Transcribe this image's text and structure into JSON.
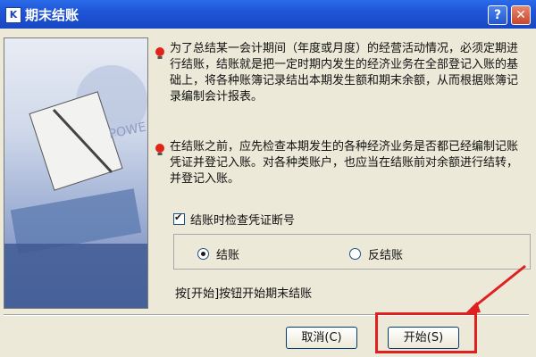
{
  "window": {
    "title": "期末结账",
    "app_icon_text": "K",
    "help_label": "?",
    "close_label": "✕"
  },
  "tips": [
    "为了总结某一会计期间（年度或月度）的经营活动情况，必须定期进行结账，结账就是把一定时期内发生的经济业务在全部登记入账的基础上，将各种账簿记录结出本期发生额和期末余额，从而根据账簿记录编制会计报表。",
    "在结账之前，应先检查本期发生的各种经济业务是否都已经编制记账凭证并登记入账。对各种类账户，也应当在结账前对余额进行结转，并登记入账。"
  ],
  "check_option": {
    "label": "结账时检查凭证断号",
    "checked": true
  },
  "radio_options": [
    {
      "label": "结账",
      "selected": true
    },
    {
      "label": "反结账",
      "selected": false
    }
  ],
  "hint": "按[开始]按钮开始期末结账",
  "buttons": {
    "cancel": "取消(C)",
    "start": "开始(S)"
  },
  "colors": {
    "title_bar": "#1f55d8",
    "highlight": "#e02020",
    "window_bg": "#ece9d8"
  }
}
